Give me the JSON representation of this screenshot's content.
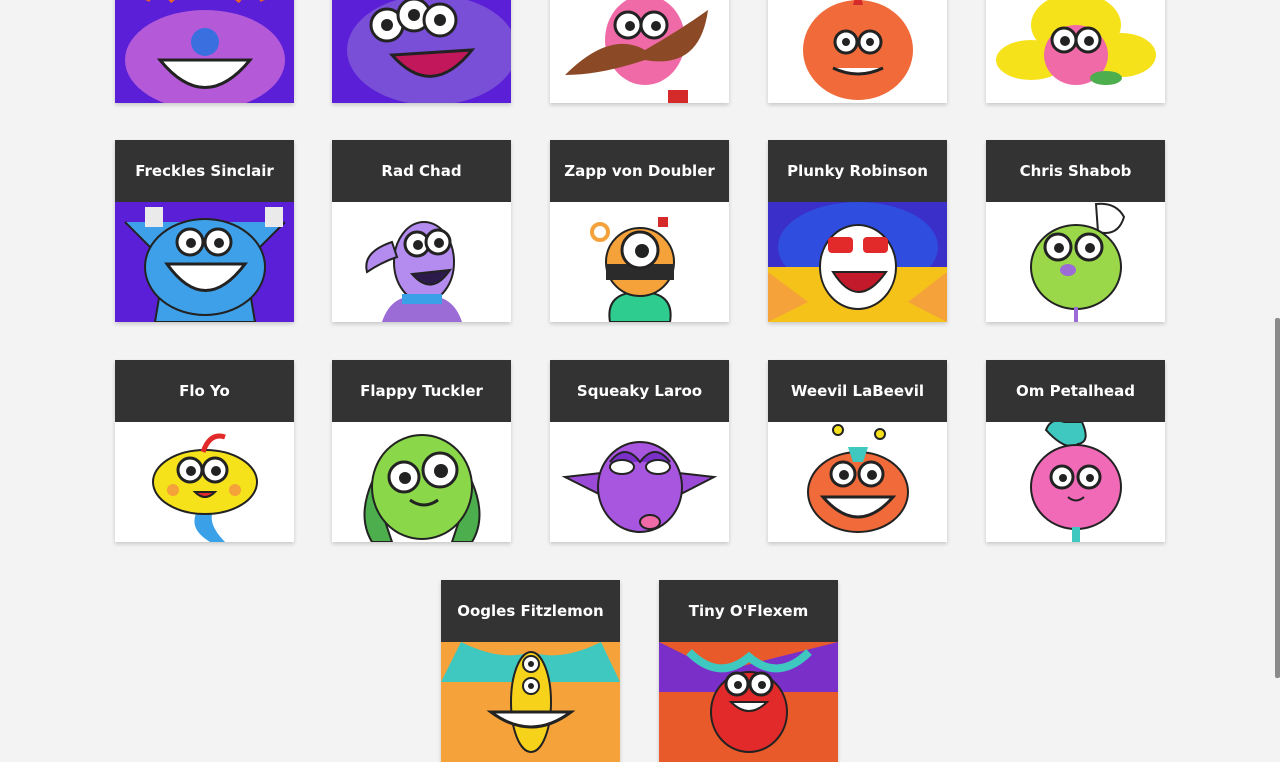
{
  "top_row": [
    {
      "icon": "horned-purple-monster-icon"
    },
    {
      "icon": "three-eyed-purple-monster-icon"
    },
    {
      "icon": "mustache-pink-monster-icon"
    },
    {
      "icon": "furry-orange-monster-icon"
    },
    {
      "icon": "yellow-haired-pink-monster-icon"
    }
  ],
  "characters": [
    {
      "name": "Freckles Sinclair",
      "icon": "freckles-sinclair-icon"
    },
    {
      "name": "Rad Chad",
      "icon": "rad-chad-icon"
    },
    {
      "name": "Zapp von Doubler",
      "icon": "zapp-von-doubler-icon"
    },
    {
      "name": "Plunky Robinson",
      "icon": "plunky-robinson-icon"
    },
    {
      "name": "Chris Shabob",
      "icon": "chris-shabob-icon"
    },
    {
      "name": "Flo Yo",
      "icon": "flo-yo-icon"
    },
    {
      "name": "Flappy Tuckler",
      "icon": "flappy-tuckler-icon"
    },
    {
      "name": "Squeaky Laroo",
      "icon": "squeaky-laroo-icon"
    },
    {
      "name": "Weevil LaBeevil",
      "icon": "weevil-labeevil-icon"
    },
    {
      "name": "Om Petalhead",
      "icon": "om-petalhead-icon"
    },
    {
      "name": "Oogles Fitzlemon",
      "icon": "oogles-fitzlemon-icon"
    },
    {
      "name": "Tiny O'Flexem",
      "icon": "tiny-oflexem-icon"
    }
  ],
  "colors": {
    "page_background": "#f3f3f3",
    "header_background": "#333333",
    "header_text": "#ffffff",
    "accent_purple": "#5a1fd6"
  }
}
